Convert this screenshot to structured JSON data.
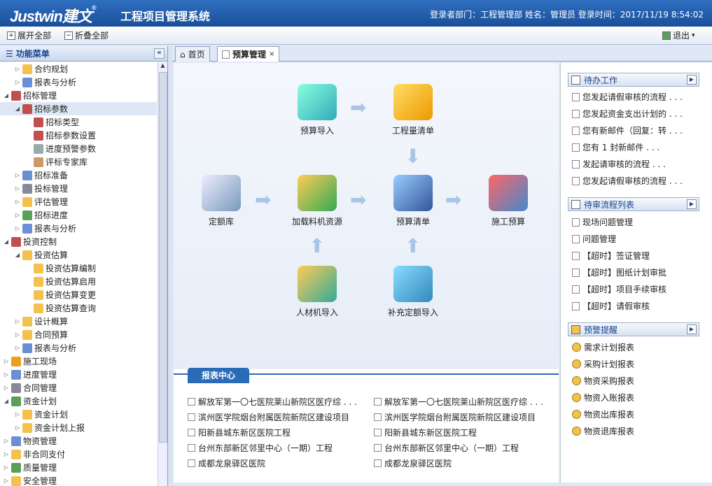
{
  "header": {
    "logo": "Justwin",
    "logo_cn": "建文",
    "reg": "®",
    "title": "工程项目管理系统",
    "login_info": "登录者部门：工程管理部 姓名：管理员 登录时间：2017/11/19 8:54:02"
  },
  "toolbar": {
    "expand": "展开全部",
    "collapse": "折叠全部",
    "logout": "退出"
  },
  "sidebar": {
    "title": "功能菜单",
    "items": [
      {
        "label": "合约规划",
        "level": 1,
        "tw": "▷",
        "color": "#f4c14c"
      },
      {
        "label": "报表与分析",
        "level": 1,
        "tw": "▷",
        "color": "#6a8fd4"
      },
      {
        "label": "招标管理",
        "level": 0,
        "tw": "◢",
        "color": "#c0504d"
      },
      {
        "label": "招标参数",
        "level": 1,
        "tw": "◢",
        "color": "#c0504d",
        "selected": true
      },
      {
        "label": "招标类型",
        "level": 2,
        "tw": "",
        "color": "#c0504d"
      },
      {
        "label": "招标参数设置",
        "level": 2,
        "tw": "",
        "color": "#c0504d"
      },
      {
        "label": "进度预警参数",
        "level": 2,
        "tw": "",
        "color": "#9aa"
      },
      {
        "label": "评标专家库",
        "level": 2,
        "tw": "",
        "color": "#c96"
      },
      {
        "label": "招标准备",
        "level": 1,
        "tw": "▷",
        "color": "#6a8fd4"
      },
      {
        "label": "投标管理",
        "level": 1,
        "tw": "▷",
        "color": "#889"
      },
      {
        "label": "评估管理",
        "level": 1,
        "tw": "▷",
        "color": "#f4c14c"
      },
      {
        "label": "招标进度",
        "level": 1,
        "tw": "▷",
        "color": "#5aa05a"
      },
      {
        "label": "报表与分析",
        "level": 1,
        "tw": "▷",
        "color": "#6a8fd4"
      },
      {
        "label": "投资控制",
        "level": 0,
        "tw": "◢",
        "color": "#c0504d"
      },
      {
        "label": "投资估算",
        "level": 1,
        "tw": "◢",
        "color": "#f4c14c"
      },
      {
        "label": "投资估算编制",
        "level": 2,
        "tw": "",
        "color": "#f4c14c"
      },
      {
        "label": "投资估算启用",
        "level": 2,
        "tw": "",
        "color": "#f4c14c"
      },
      {
        "label": "投资估算变更",
        "level": 2,
        "tw": "",
        "color": "#f4c14c"
      },
      {
        "label": "投资估算查询",
        "level": 2,
        "tw": "",
        "color": "#f4c14c"
      },
      {
        "label": "设计概算",
        "level": 1,
        "tw": "▷",
        "color": "#f4c14c"
      },
      {
        "label": "合同预算",
        "level": 1,
        "tw": "▷",
        "color": "#f4c14c"
      },
      {
        "label": "报表与分析",
        "level": 1,
        "tw": "▷",
        "color": "#6a8fd4"
      },
      {
        "label": "施工现场",
        "level": 0,
        "tw": "▷",
        "color": "#e8a020"
      },
      {
        "label": "进度管理",
        "level": 0,
        "tw": "▷",
        "color": "#6a8fd4"
      },
      {
        "label": "合同管理",
        "level": 0,
        "tw": "▷",
        "color": "#889"
      },
      {
        "label": "资金计划",
        "level": 0,
        "tw": "◢",
        "color": "#5aa05a"
      },
      {
        "label": "资金计划",
        "level": 1,
        "tw": "▷",
        "color": "#f4c14c"
      },
      {
        "label": "资金计划上报",
        "level": 1,
        "tw": "▷",
        "color": "#f4c14c"
      },
      {
        "label": "物资管理",
        "level": 0,
        "tw": "▷",
        "color": "#6a8fd4"
      },
      {
        "label": "非合同支付",
        "level": 0,
        "tw": "▷",
        "color": "#f4c14c"
      },
      {
        "label": "质量管理",
        "level": 0,
        "tw": "▷",
        "color": "#5aa05a"
      },
      {
        "label": "安全管理",
        "level": 0,
        "tw": "▷",
        "color": "#f4c14c"
      }
    ]
  },
  "tabs": [
    {
      "label": "首页"
    },
    {
      "label": "预算管理",
      "close": "×"
    }
  ],
  "flow": {
    "nodes": [
      "预算导入",
      "工程量清单",
      "定额库",
      "加载料机资源",
      "预算清单",
      "施工预算",
      "人材机导入",
      "补充定额导入"
    ]
  },
  "report": {
    "title": "报表中心",
    "left": [
      "解放军第一〇七医院莱山新院区医疗综 . . .",
      "滨州医学院烟台附属医院新院区建设项目",
      "阳新县城东新区医院工程",
      "台州东部新区邻里中心（一期）工程",
      "成都龙泉驿区医院"
    ],
    "right": [
      "解放军第一〇七医院莱山新院区医疗综 . . .",
      "滨州医学院烟台附属医院新院区建设项目",
      "阳新县城东新区医院工程",
      "台州东部新区邻里中心（一期）工程",
      "成都龙泉驿区医院"
    ]
  },
  "todo": {
    "title": "待办工作",
    "items": [
      "您发起请假审核的流程 . . .",
      "您发起资金支出计划的 . . .",
      "您有新邮件（回复：转 . . .",
      "您有 1 封新邮件 . . .",
      "发起请审核的流程 . . .",
      "您发起请假审核的流程 . . ."
    ]
  },
  "review": {
    "title": "待审流程列表",
    "items": [
      "现场问题管理",
      "问题管理",
      "【超时】签证管理",
      "【超时】图纸计划审批",
      "【超时】项目手续审核",
      "【超时】请假审核"
    ]
  },
  "alert": {
    "title": "预警提醒",
    "items": [
      "需求计划报表",
      "采购计划报表",
      "物资采购报表",
      "物资入账报表",
      "物资出库报表",
      "物资退库报表"
    ]
  }
}
